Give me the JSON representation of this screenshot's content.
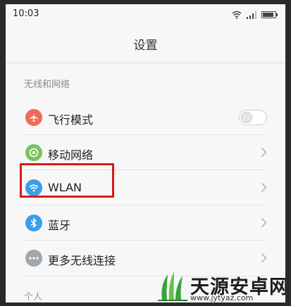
{
  "status_bar": {
    "time": "10:03",
    "icons": [
      "wifi-icon",
      "signal-icon",
      "battery-icon"
    ]
  },
  "header": {
    "title": "设置"
  },
  "section": {
    "title": "无线和网络"
  },
  "rows": [
    {
      "label": "飞行模式",
      "icon": "airplane-icon",
      "icon_color": "#ef6b57",
      "control": "toggle",
      "toggle_on": false
    },
    {
      "label": "移动网络",
      "icon": "mobile-network-icon",
      "icon_color": "#7cc15a",
      "control": "chevron"
    },
    {
      "label": "WLAN",
      "icon": "wifi-icon",
      "icon_color": "#3a9fe8",
      "control": "chevron"
    },
    {
      "label": "蓝牙",
      "icon": "bluetooth-icon",
      "icon_color": "#3a9fe8",
      "control": "chevron"
    },
    {
      "label": "更多无线连接",
      "icon": "more-icon",
      "icon_color": "#9fa7ad",
      "control": "chevron"
    }
  ],
  "bottom_section": {
    "title": "个人"
  },
  "highlight": {
    "color": "#d71a1a",
    "target": "WLAN"
  },
  "watermark": {
    "title": "天源安卓网",
    "url": "www.jytyaz.com"
  }
}
